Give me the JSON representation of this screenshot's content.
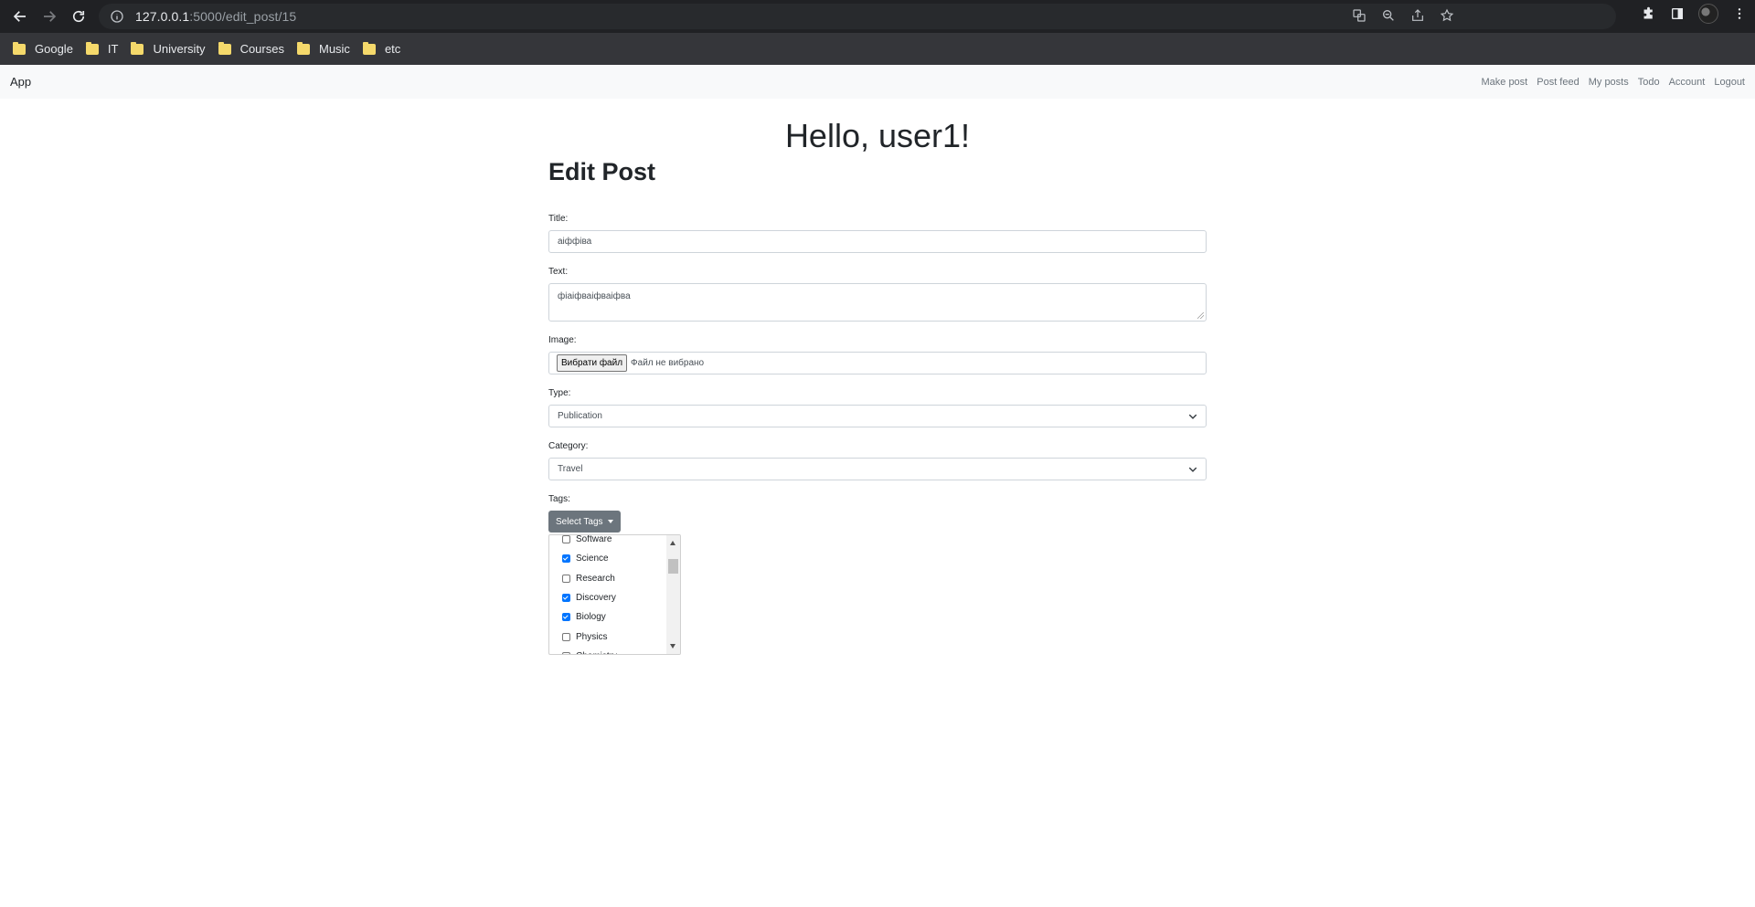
{
  "browser": {
    "url_host": "127.0.0.1",
    "url_path": ":5000/edit_post/15",
    "bookmarks": [
      {
        "label": "Google"
      },
      {
        "label": "IT"
      },
      {
        "label": "University"
      },
      {
        "label": "Courses"
      },
      {
        "label": "Music"
      },
      {
        "label": "etc"
      }
    ]
  },
  "navbar": {
    "brand": "App",
    "links": [
      "Make post",
      "Post feed",
      "My posts",
      "Todo",
      "Account",
      "Logout"
    ]
  },
  "greeting": "Hello, user1!",
  "heading": "Edit Post",
  "form": {
    "title_label": "Title:",
    "title_value": "аіффіва",
    "text_label": "Text:",
    "text_value": "фіаіфваіфваіфва",
    "image_label": "Image:",
    "file_button": "Вибрати файл",
    "file_status": "Файл не вибрано",
    "type_label": "Type:",
    "type_value": "Publication",
    "category_label": "Category:",
    "category_value": "Travel",
    "tags_label": "Tags:",
    "tags_button": "Select Tags"
  },
  "tags": [
    {
      "label": "Software",
      "checked": false
    },
    {
      "label": "Science",
      "checked": true
    },
    {
      "label": "Research",
      "checked": false
    },
    {
      "label": "Discovery",
      "checked": true
    },
    {
      "label": "Biology",
      "checked": true
    },
    {
      "label": "Physics",
      "checked": false
    },
    {
      "label": "Chemistry",
      "checked": false
    }
  ]
}
